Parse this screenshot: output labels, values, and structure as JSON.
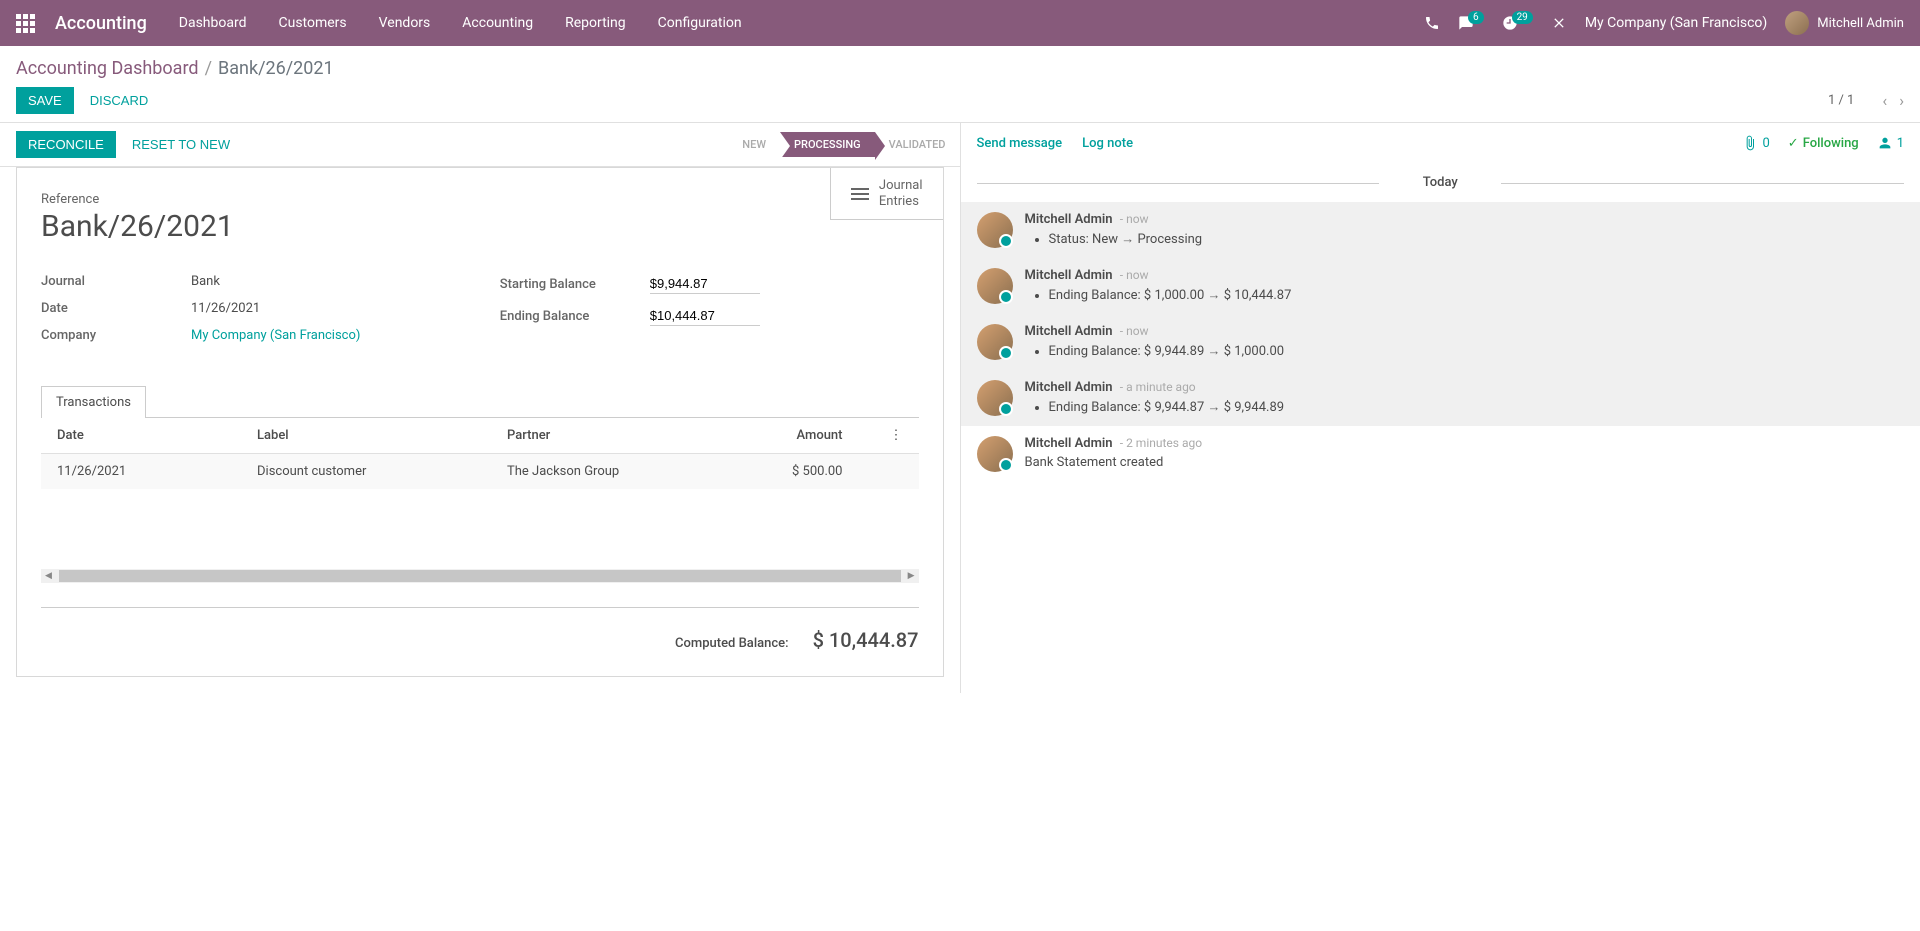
{
  "topbar": {
    "app_title": "Accounting",
    "nav": [
      "Dashboard",
      "Customers",
      "Vendors",
      "Accounting",
      "Reporting",
      "Configuration"
    ],
    "badge_messages": "6",
    "badge_activities": "29",
    "company": "My Company (San Francisco)",
    "user": "Mitchell Admin"
  },
  "breadcrumb": {
    "parent": "Accounting Dashboard",
    "current": "Bank/26/2021"
  },
  "toolbar": {
    "save": "SAVE",
    "discard": "DISCARD",
    "pager": "1 / 1"
  },
  "statusbar": {
    "reconcile": "RECONCILE",
    "reset": "RESET TO NEW",
    "steps": [
      "NEW",
      "PROCESSING",
      "VALIDATED"
    ]
  },
  "stat_button": {
    "line1": "Journal",
    "line2": "Entries"
  },
  "form": {
    "ref_label": "Reference",
    "ref_value": "Bank/26/2021",
    "journal_label": "Journal",
    "journal_value": "Bank",
    "date_label": "Date",
    "date_value": "11/26/2021",
    "company_label": "Company",
    "company_value": "My Company (San Francisco)",
    "start_bal_label": "Starting Balance",
    "start_bal_value": "$9,944.87",
    "end_bal_label": "Ending Balance",
    "end_bal_value": "$10,444.87"
  },
  "tabs": {
    "transactions": "Transactions"
  },
  "trans_header": {
    "date": "Date",
    "label": "Label",
    "partner": "Partner",
    "amount": "Amount"
  },
  "trans_rows": [
    {
      "date": "11/26/2021",
      "label": "Discount customer",
      "partner": "The Jackson Group",
      "amount": "$ 500.00"
    }
  ],
  "computed": {
    "label": "Computed Balance:",
    "value": "$ 10,444.87"
  },
  "chatter": {
    "send": "Send message",
    "log": "Log note",
    "attach_count": "0",
    "following": "Following",
    "followers": "1",
    "today": "Today",
    "messages": [
      {
        "author": "Mitchell Admin",
        "time": "- now",
        "body": "Status: New → Processing",
        "highlighted": true,
        "bullet": true
      },
      {
        "author": "Mitchell Admin",
        "time": "- now",
        "body": "Ending Balance: $ 1,000.00 → $ 10,444.87",
        "highlighted": true,
        "bullet": true
      },
      {
        "author": "Mitchell Admin",
        "time": "- now",
        "body": "Ending Balance: $ 9,944.89 → $ 1,000.00",
        "highlighted": true,
        "bullet": true
      },
      {
        "author": "Mitchell Admin",
        "time": "- a minute ago",
        "body": "Ending Balance: $ 9,944.87 → $ 9,944.89",
        "highlighted": true,
        "bullet": true
      },
      {
        "author": "Mitchell Admin",
        "time": "- 2 minutes ago",
        "body": "Bank Statement created",
        "highlighted": false,
        "bullet": false
      }
    ]
  }
}
